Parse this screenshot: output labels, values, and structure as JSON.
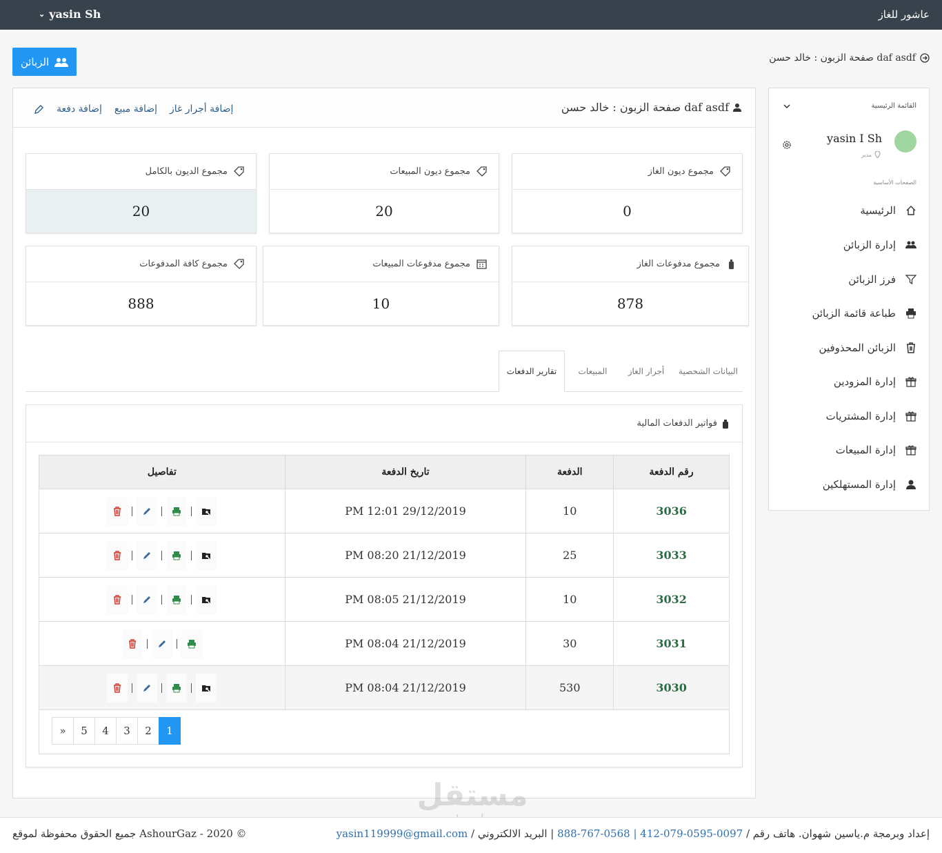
{
  "topbar": {
    "brand": "عاشور للغاز",
    "user": "yasin Sh"
  },
  "header": {
    "customers_button": "الزبائن",
    "crumb": "صفحة الزبون : خالد حسن daf asdf"
  },
  "main": {
    "title": "صفحة الزبون : خالد حسن daf asdf",
    "actions": [
      "إضافة أجرار غاز",
      "إضافة مبيع",
      "إضافة دفعة"
    ]
  },
  "stats": [
    {
      "label": "مجموع ديون الغاز",
      "value": "0",
      "icon": "tag-icon"
    },
    {
      "label": "مجموع ديون المبيعات",
      "value": "20",
      "icon": "tag-icon"
    },
    {
      "label": "مجموع الديون بالكامل",
      "value": "20",
      "icon": "tag-icon"
    },
    {
      "label": "مجموع مدفوعات الغاز",
      "value": "878",
      "icon": "gas-bottle-icon"
    },
    {
      "label": "مجموع مدفوعات المبيعات",
      "value": "10",
      "icon": "calendar-icon"
    },
    {
      "label": "مجموع كافة المدفوعات",
      "value": "888",
      "icon": "tag-icon"
    }
  ],
  "tabs": [
    "البيانات الشخصية",
    "أجرار الغاز",
    "المبيعات",
    "تقارير الدفعات"
  ],
  "invoices": {
    "title": "فواتير الدفعات المالية",
    "columns": [
      "رقم الدفعة",
      "الدفعة",
      "تاريخ الدفعة",
      "تفاصيل"
    ],
    "rows": [
      {
        "id": "3036",
        "amount": "10",
        "date": "PM 12:01 29/12/2019"
      },
      {
        "id": "3033",
        "amount": "25",
        "date": "PM 08:20 21/12/2019"
      },
      {
        "id": "3032",
        "amount": "10",
        "date": "PM 08:05 21/12/2019"
      },
      {
        "id": "3031",
        "amount": "30",
        "date": "PM 08:04 21/12/2019"
      },
      {
        "id": "3030",
        "amount": "530",
        "date": "PM 08:04 21/12/2019"
      }
    ],
    "pages": [
      "1",
      "2",
      "3",
      "4",
      "5",
      "»"
    ]
  },
  "sidebar": {
    "menu_title": "القائمة الرئيسية",
    "user_name": "yasin I Sh",
    "role": "مدير",
    "section": "الصفحات الأساسية",
    "items": [
      {
        "label": "الرئيسية",
        "icon": "home-icon"
      },
      {
        "label": "إدارة الزبائن",
        "icon": "users-icon"
      },
      {
        "label": "فرز الزبائن",
        "icon": "filter-icon"
      },
      {
        "label": "طباعة قائمة الزبائن",
        "icon": "printer-icon"
      },
      {
        "label": "الزبائن المحذوفين",
        "icon": "trash-icon"
      },
      {
        "label": "إدارة المزودين",
        "icon": "gift-icon"
      },
      {
        "label": "إدارة المشتريات",
        "icon": "gift-icon"
      },
      {
        "label": "إدارة المبيعات",
        "icon": "gift-icon"
      },
      {
        "label": "إدارة المستهلكين",
        "icon": "user-icon"
      }
    ]
  },
  "footer": {
    "prefix": "إعداد وبرمجة م.ياسين شهوان. هاتف رقم / ",
    "phones": "0097-0595-079-412 | 0568-767-888",
    "email_label": " | البريد الالكتروني / ",
    "email": "yasin119999@gmail.com",
    "copyright": "جميع الحقوق محفوظة لموقع AshourGaz - 2020 ©"
  },
  "watermark": {
    "arabic": "مستقل",
    "latin": "mostaql.com"
  }
}
